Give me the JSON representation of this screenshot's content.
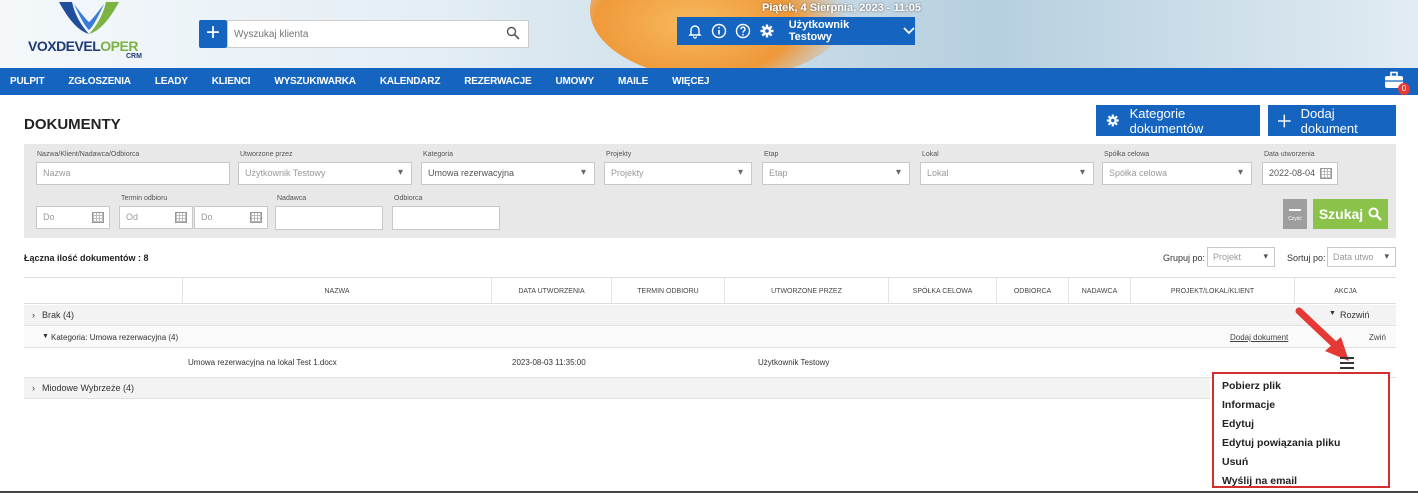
{
  "header": {
    "logo_text_a": "VOXDEVEL",
    "logo_text_b": "OPER",
    "logo_sub": "CRM",
    "add_client_label": "+",
    "search_placeholder": "Wyszukaj klienta",
    "date": "Piątek, 4 Sierpnia, 2023 - 11:05",
    "user_name": "Użytkownik Testowy"
  },
  "nav": {
    "items": [
      "PULPIT",
      "ZGŁOSZENIA",
      "LEADY",
      "KLIENCI",
      "WYSZUKIWARKA",
      "KALENDARZ",
      "REZERWACJE",
      "UMOWY",
      "MAILE",
      "WIĘCEJ"
    ],
    "cart_count": "0"
  },
  "page": {
    "title": "DOKUMENTY",
    "btn_categories": "Kategorie dokumentów",
    "btn_add": "Dodaj dokument"
  },
  "filters": {
    "name_label": "Nazwa/Klient/Nadawca/Odbiorca",
    "name_placeholder": "Nazwa",
    "created_by_label": "Utworzone przez",
    "created_by_value": "Użytkownik Testowy",
    "category_label": "Kategoria",
    "category_value": "Umowa rezerwacyjna",
    "projects_label": "Projekty",
    "projects_placeholder": "Projekty",
    "stage_label": "Etap",
    "stage_placeholder": "Etap",
    "unit_label": "Lokal",
    "unit_placeholder": "Lokal",
    "company_label": "Spółka celowa",
    "company_placeholder": "Spółka celowa",
    "created_date_label": "Data utworzenia",
    "created_date_value": "2022-08-04",
    "do1_placeholder": "Do",
    "deadline_label": "Termin odbioru",
    "od_placeholder": "Od",
    "do2_placeholder": "Do",
    "sender_label": "Nadawca",
    "recipient_label": "Odbiorca",
    "clear_label": "Czyść",
    "search_label": "Szukaj"
  },
  "summary": {
    "total": "Łączna ilość dokumentów : 8",
    "group_label": "Grupuj po:",
    "group_value": "Projekt",
    "sort_label": "Sortuj po:",
    "sort_value": "Data utwo"
  },
  "table": {
    "headers": [
      "NAZWA",
      "DATA UTWORZENIA",
      "TERMIN ODBIORU",
      "UTWORZONE PRZEZ",
      "SPÓŁKA CELOWA",
      "ODBIORCA",
      "NADAWCA",
      "PROJEKT/LOKAL/KLIENT",
      "AKCJA"
    ],
    "group1": "Brak (4)",
    "expand": "Rozwiń",
    "category": "Kategoria: Umowa rezerwacyjna (4)",
    "add_doc_link": "Dodaj dokument",
    "collapse": "Zwiń",
    "doc_name": "Umowa rezerwacyjna na lokal Test 1.docx",
    "doc_date": "2023-08-03 11:35:00",
    "doc_author": "Użytkownik Testowy",
    "group2": "Miodowe Wybrzeże (4)"
  },
  "context_menu": {
    "items": [
      "Pobierz plik",
      "Informacje",
      "Edytuj",
      "Edytuj powiązania pliku",
      "Usuń",
      "Wyślij na email"
    ]
  }
}
